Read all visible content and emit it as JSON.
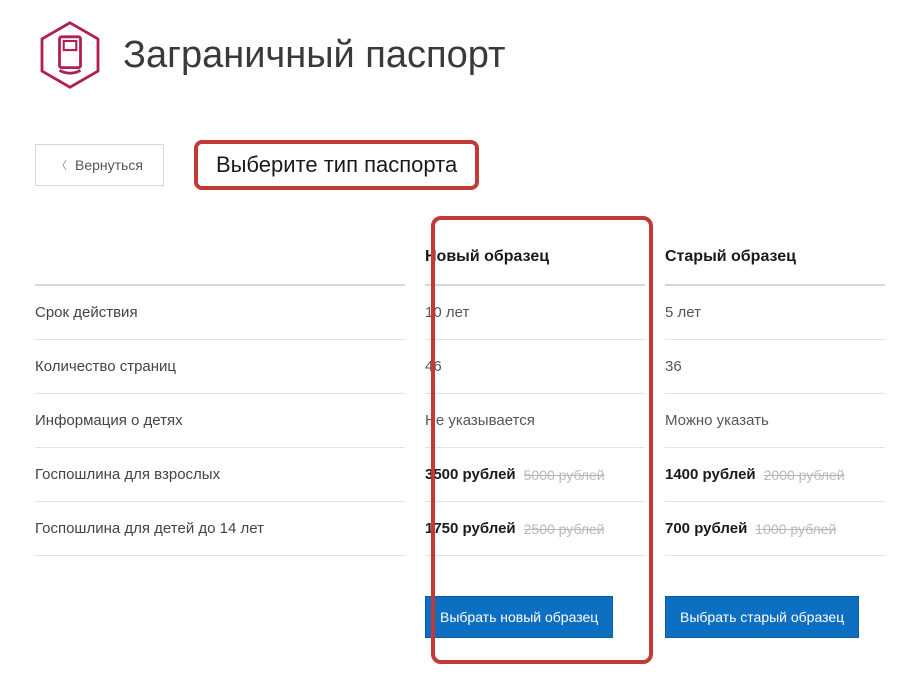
{
  "header": {
    "title": "Заграничный паспорт"
  },
  "back_button": "Вернуться",
  "subtitle": "Выберите тип паспорта",
  "columns": {
    "new": "Новый образец",
    "old": "Старый образец"
  },
  "rows": {
    "validity": {
      "label": "Срок действия",
      "new": "10 лет",
      "old": "5 лет"
    },
    "pages": {
      "label": "Количество страниц",
      "new": "46",
      "old": "36"
    },
    "children": {
      "label": "Информация о детях",
      "new": "Не указывается",
      "old": "Можно указать"
    },
    "fee_adult": {
      "label": "Госпошлина для взрослых",
      "new": "3500 рублей",
      "new_strike": "5000 рублей",
      "old": "1400 рублей",
      "old_strike": "2000 рублей"
    },
    "fee_child": {
      "label": "Госпошлина для детей до 14 лет",
      "new": "1750 рублей",
      "new_strike": "2500 рублей",
      "old": "700 рублей",
      "old_strike": "1000 рублей"
    }
  },
  "buttons": {
    "new": "Выбрать новый образец",
    "old": "Выбрать старый образец"
  }
}
